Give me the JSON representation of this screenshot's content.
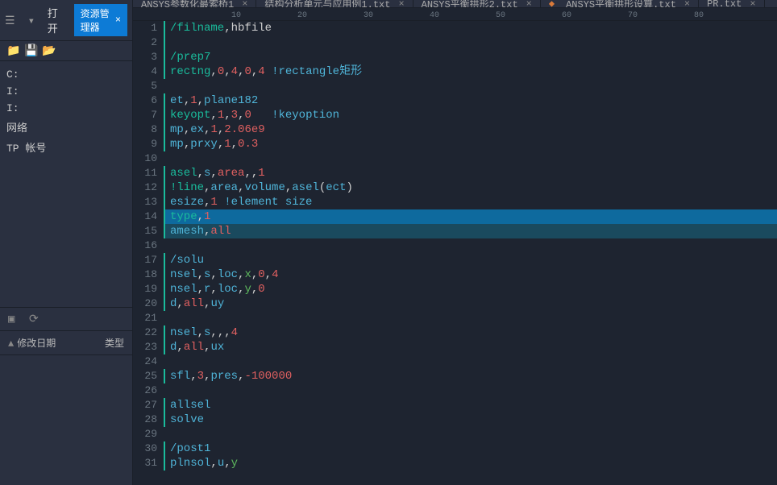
{
  "sidebar": {
    "open_label": "打开",
    "res_mgr_label": "资源管理器",
    "tree": [
      "C:",
      "I:",
      "I:",
      "网络",
      "TP 帐号"
    ],
    "columns": {
      "mod": "修改日期",
      "type": "类型"
    }
  },
  "tabs": [
    {
      "label": "ANSYS参数化最索桥1",
      "modified": false
    },
    {
      "label": "结构分析单元与应用例1.txt",
      "modified": false
    },
    {
      "label": "ANSYS平衡拱形2.txt",
      "modified": false
    },
    {
      "label": "ANSYS平衡拱形设算.txt",
      "modified": true
    },
    {
      "label": "PR.txt",
      "modified": false
    }
  ],
  "ruler": [
    "10",
    "20",
    "30",
    "40",
    "50",
    "60",
    "70",
    "80"
  ],
  "code": [
    {
      "n": 1,
      "bar": true,
      "tokens": [
        [
          "/filname",
          "c-fn"
        ],
        [
          ",",
          "c-wh"
        ],
        [
          "hbfile",
          "c-wh"
        ]
      ]
    },
    {
      "n": 2,
      "bar": true,
      "tokens": []
    },
    {
      "n": 3,
      "bar": true,
      "tokens": [
        [
          "/prep7",
          "c-fn"
        ]
      ]
    },
    {
      "n": 4,
      "bar": true,
      "tokens": [
        [
          "rectng",
          "c-fn"
        ],
        [
          ",",
          "c-wh"
        ],
        [
          "0",
          "c-red"
        ],
        [
          ",",
          "c-wh"
        ],
        [
          "4",
          "c-red"
        ],
        [
          ",",
          "c-wh"
        ],
        [
          "0",
          "c-red"
        ],
        [
          ",",
          "c-wh"
        ],
        [
          "4",
          "c-red"
        ],
        [
          " !rectangle矩形",
          "c-kw"
        ]
      ]
    },
    {
      "n": 5,
      "tokens": []
    },
    {
      "n": 6,
      "bar": true,
      "tokens": [
        [
          "et",
          "c-kw"
        ],
        [
          ",",
          "c-wh"
        ],
        [
          "1",
          "c-red"
        ],
        [
          ",",
          "c-wh"
        ],
        [
          "plane182",
          "c-kw"
        ]
      ]
    },
    {
      "n": 7,
      "bar": true,
      "tokens": [
        [
          "keyopt",
          "c-fn"
        ],
        [
          ",",
          "c-wh"
        ],
        [
          "1",
          "c-red"
        ],
        [
          ",",
          "c-wh"
        ],
        [
          "3",
          "c-red"
        ],
        [
          ",",
          "c-wh"
        ],
        [
          "0",
          "c-red"
        ],
        [
          "   !keyoption",
          "c-kw"
        ]
      ]
    },
    {
      "n": 8,
      "bar": true,
      "tokens": [
        [
          "mp",
          "c-kw"
        ],
        [
          ",",
          "c-wh"
        ],
        [
          "ex",
          "c-kw"
        ],
        [
          ",",
          "c-wh"
        ],
        [
          "1",
          "c-red"
        ],
        [
          ",",
          "c-wh"
        ],
        [
          "2.06e9",
          "c-red"
        ]
      ]
    },
    {
      "n": 9,
      "bar": true,
      "tokens": [
        [
          "mp",
          "c-kw"
        ],
        [
          ",",
          "c-wh"
        ],
        [
          "prxy",
          "c-kw"
        ],
        [
          ",",
          "c-wh"
        ],
        [
          "1",
          "c-red"
        ],
        [
          ",",
          "c-wh"
        ],
        [
          "0.3",
          "c-red"
        ]
      ]
    },
    {
      "n": 10,
      "tokens": []
    },
    {
      "n": 11,
      "bar": true,
      "tokens": [
        [
          "asel",
          "c-fn"
        ],
        [
          ",",
          "c-wh"
        ],
        [
          "s",
          "c-kw"
        ],
        [
          ",",
          "c-wh"
        ],
        [
          "area",
          "c-red"
        ],
        [
          ",,",
          "c-wh"
        ],
        [
          "1",
          "c-red"
        ]
      ]
    },
    {
      "n": 12,
      "bar": true,
      "tokens": [
        [
          "!line",
          "c-fn"
        ],
        [
          ",",
          "c-wh"
        ],
        [
          "area",
          "c-kw"
        ],
        [
          ",",
          "c-wh"
        ],
        [
          "volume",
          "c-kw"
        ],
        [
          ",",
          "c-wh"
        ],
        [
          "asel",
          "c-kw"
        ],
        [
          "(",
          "c-wh"
        ],
        [
          "ect",
          "c-kw"
        ],
        [
          ")",
          "c-wh"
        ]
      ]
    },
    {
      "n": 13,
      "bar": true,
      "tokens": [
        [
          "esize",
          "c-kw"
        ],
        [
          ",",
          "c-wh"
        ],
        [
          "1",
          "c-red"
        ],
        [
          " !element size",
          "c-kw"
        ]
      ]
    },
    {
      "n": 14,
      "bar": true,
      "hl": true,
      "tokens": [
        [
          "type",
          "c-fn"
        ],
        [
          ",",
          "c-wh"
        ],
        [
          "1",
          "c-red"
        ]
      ]
    },
    {
      "n": 15,
      "bar": true,
      "hl_dark": true,
      "tokens": [
        [
          "amesh",
          "c-kw"
        ],
        [
          ",",
          "c-wh"
        ],
        [
          "all",
          "c-red"
        ]
      ]
    },
    {
      "n": 16,
      "tokens": []
    },
    {
      "n": 17,
      "bar": true,
      "tokens": [
        [
          "/solu",
          "c-kw"
        ]
      ]
    },
    {
      "n": 18,
      "bar": true,
      "tokens": [
        [
          "nsel",
          "c-kw"
        ],
        [
          ",",
          "c-wh"
        ],
        [
          "s",
          "c-kw"
        ],
        [
          ",",
          "c-wh"
        ],
        [
          "loc",
          "c-kw"
        ],
        [
          ",",
          "c-wh"
        ],
        [
          "x",
          "c-gn"
        ],
        [
          ",",
          "c-wh"
        ],
        [
          "0",
          "c-red"
        ],
        [
          ",",
          "c-wh"
        ],
        [
          "4",
          "c-red"
        ]
      ]
    },
    {
      "n": 19,
      "bar": true,
      "tokens": [
        [
          "nsel",
          "c-kw"
        ],
        [
          ",",
          "c-wh"
        ],
        [
          "r",
          "c-kw"
        ],
        [
          ",",
          "c-wh"
        ],
        [
          "loc",
          "c-kw"
        ],
        [
          ",",
          "c-wh"
        ],
        [
          "y",
          "c-gn"
        ],
        [
          ",",
          "c-wh"
        ],
        [
          "0",
          "c-red"
        ]
      ]
    },
    {
      "n": 20,
      "bar": true,
      "tokens": [
        [
          "d",
          "c-kw"
        ],
        [
          ",",
          "c-wh"
        ],
        [
          "all",
          "c-red"
        ],
        [
          ",",
          "c-wh"
        ],
        [
          "uy",
          "c-kw"
        ]
      ]
    },
    {
      "n": 21,
      "tokens": []
    },
    {
      "n": 22,
      "bar": true,
      "tokens": [
        [
          "nsel",
          "c-kw"
        ],
        [
          ",",
          "c-wh"
        ],
        [
          "s",
          "c-kw"
        ],
        [
          ",,,",
          "c-wh"
        ],
        [
          "4",
          "c-red"
        ]
      ]
    },
    {
      "n": 23,
      "bar": true,
      "tokens": [
        [
          "d",
          "c-kw"
        ],
        [
          ",",
          "c-wh"
        ],
        [
          "all",
          "c-red"
        ],
        [
          ",",
          "c-wh"
        ],
        [
          "ux",
          "c-kw"
        ]
      ]
    },
    {
      "n": 24,
      "tokens": []
    },
    {
      "n": 25,
      "bar": true,
      "tokens": [
        [
          "sfl",
          "c-kw"
        ],
        [
          ",",
          "c-wh"
        ],
        [
          "3",
          "c-red"
        ],
        [
          ",",
          "c-wh"
        ],
        [
          "pres",
          "c-kw"
        ],
        [
          ",",
          "c-wh"
        ],
        [
          "-100000",
          "c-red"
        ]
      ]
    },
    {
      "n": 26,
      "tokens": []
    },
    {
      "n": 27,
      "bar": true,
      "tokens": [
        [
          "allsel",
          "c-kw"
        ]
      ]
    },
    {
      "n": 28,
      "bar": true,
      "tokens": [
        [
          "solve",
          "c-kw"
        ]
      ]
    },
    {
      "n": 29,
      "tokens": []
    },
    {
      "n": 30,
      "bar": true,
      "tokens": [
        [
          "/post1",
          "c-kw"
        ]
      ]
    },
    {
      "n": 31,
      "bar": true,
      "tokens": [
        [
          "plnsol",
          "c-kw"
        ],
        [
          ",",
          "c-wh"
        ],
        [
          "u",
          "c-kw"
        ],
        [
          ",",
          "c-wh"
        ],
        [
          "y",
          "c-gn"
        ]
      ]
    }
  ]
}
